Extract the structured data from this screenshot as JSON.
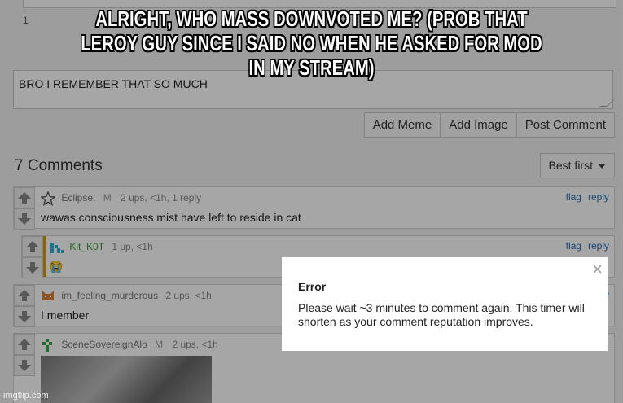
{
  "top": {
    "partial_number": "1"
  },
  "comment_input": {
    "value": "BRO I REMEMBER THAT SO MUCH"
  },
  "actions": {
    "add_meme": "Add Meme",
    "add_image": "Add Image",
    "post_comment": "Post Comment"
  },
  "comments_header": {
    "count": "7 Comments",
    "sort": "Best first"
  },
  "comment_actions": {
    "flag": "flag",
    "reply": "reply"
  },
  "comments": [
    {
      "user": "Eclipse.",
      "mod_badge": "M",
      "meta": "2 ups, <1h, 1 reply",
      "text": "wawas consciousness mist have left to reside in cat"
    },
    {
      "user": "Kit_K0T",
      "meta": "1 up, <1h",
      "text": "😭"
    },
    {
      "user": "im_feeling_murderous",
      "meta": "2 ups, <1h",
      "text": "I member"
    },
    {
      "user": "SceneSovereignAlo",
      "mod_badge": "M",
      "meta": "2 ups, <1h"
    }
  ],
  "caption": {
    "text": "ALRIGHT, WHO MASS DOWNVOTED ME? (PROB THAT LEROY GUY SINCE I SAID NO WHEN HE ASKED FOR MOD IN MY STREAM)"
  },
  "error_modal": {
    "close": "×",
    "title": "Error",
    "message": "Please wait ~3 minutes to comment again. This timer will shorten as your comment reputation improves."
  },
  "watermark": "imgflip.com"
}
